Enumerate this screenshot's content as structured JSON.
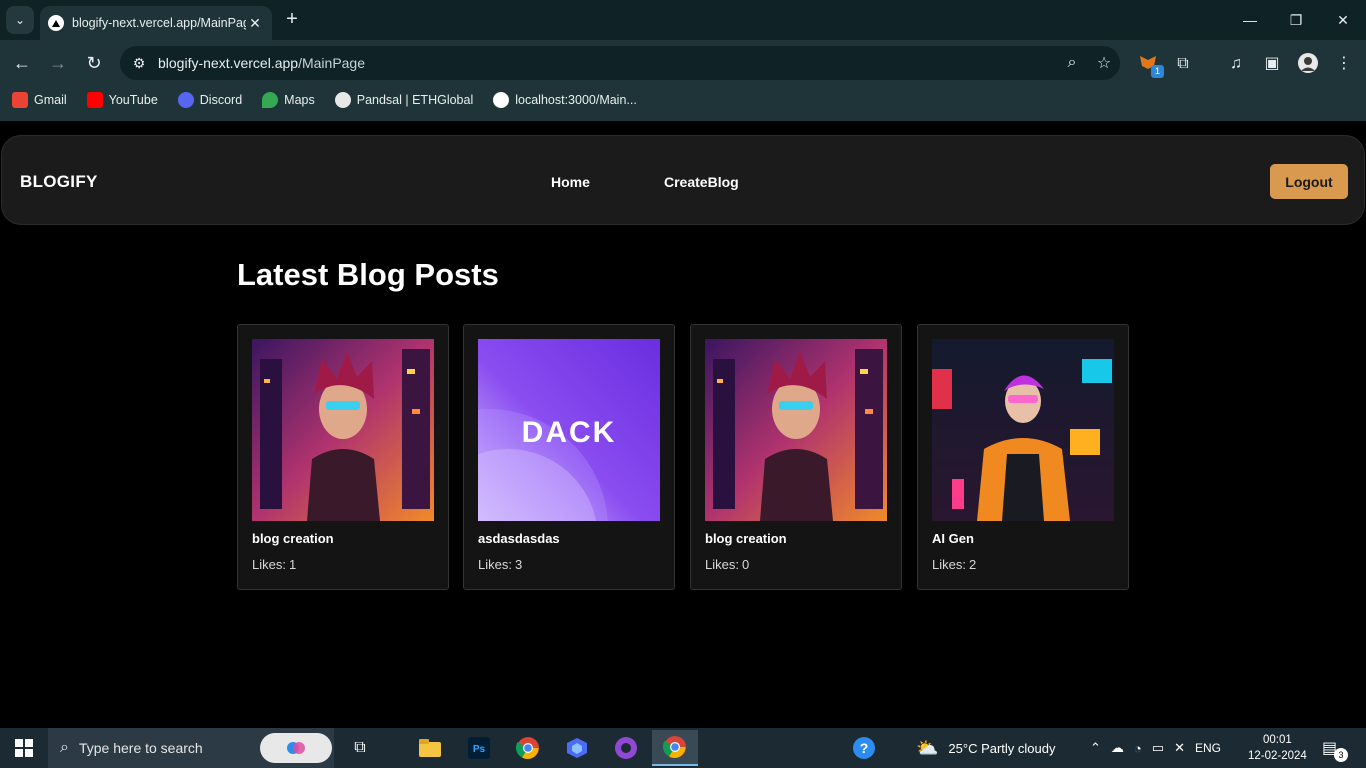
{
  "browser": {
    "tab_title": "blogify-next.vercel.app/MainPage",
    "url_host": "blogify-next.vercel.app",
    "url_path": "/MainPage",
    "extension_badge": "1",
    "bookmarks": [
      {
        "label": "Gmail",
        "color": "#ea4335"
      },
      {
        "label": "YouTube",
        "color": "#ff0000"
      },
      {
        "label": "Discord",
        "color": "#5865f2"
      },
      {
        "label": "Maps",
        "color": "#34a853"
      },
      {
        "label": "Pandsal | ETHGlobal",
        "color": "#e8e8e8"
      },
      {
        "label": "localhost:3000/Main...",
        "color": "#000000"
      }
    ]
  },
  "app": {
    "brand": "BLOGIFY",
    "nav": {
      "home": "Home",
      "create": "CreateBlog"
    },
    "logout_label": "Logout",
    "accent_color": "#d99a4f",
    "heading": "Latest Blog Posts",
    "likes_label": "Likes:",
    "posts": [
      {
        "title": "blog creation",
        "likes": "1",
        "image": "anime-cyberpunk-boy"
      },
      {
        "title": "asdasdasdas",
        "likes": "3",
        "image": "dack-purple-logo",
        "image_text": "DACK"
      },
      {
        "title": "blog creation",
        "likes": "0",
        "image": "anime-cyberpunk-boy"
      },
      {
        "title": "AI Gen",
        "likes": "2",
        "image": "neon-street-boy"
      }
    ]
  },
  "taskbar": {
    "search_placeholder": "Type here to search",
    "weather": "25°C  Partly cloudy",
    "lang": "ENG",
    "time": "00:01",
    "date": "12-02-2024",
    "notifications": "3"
  }
}
